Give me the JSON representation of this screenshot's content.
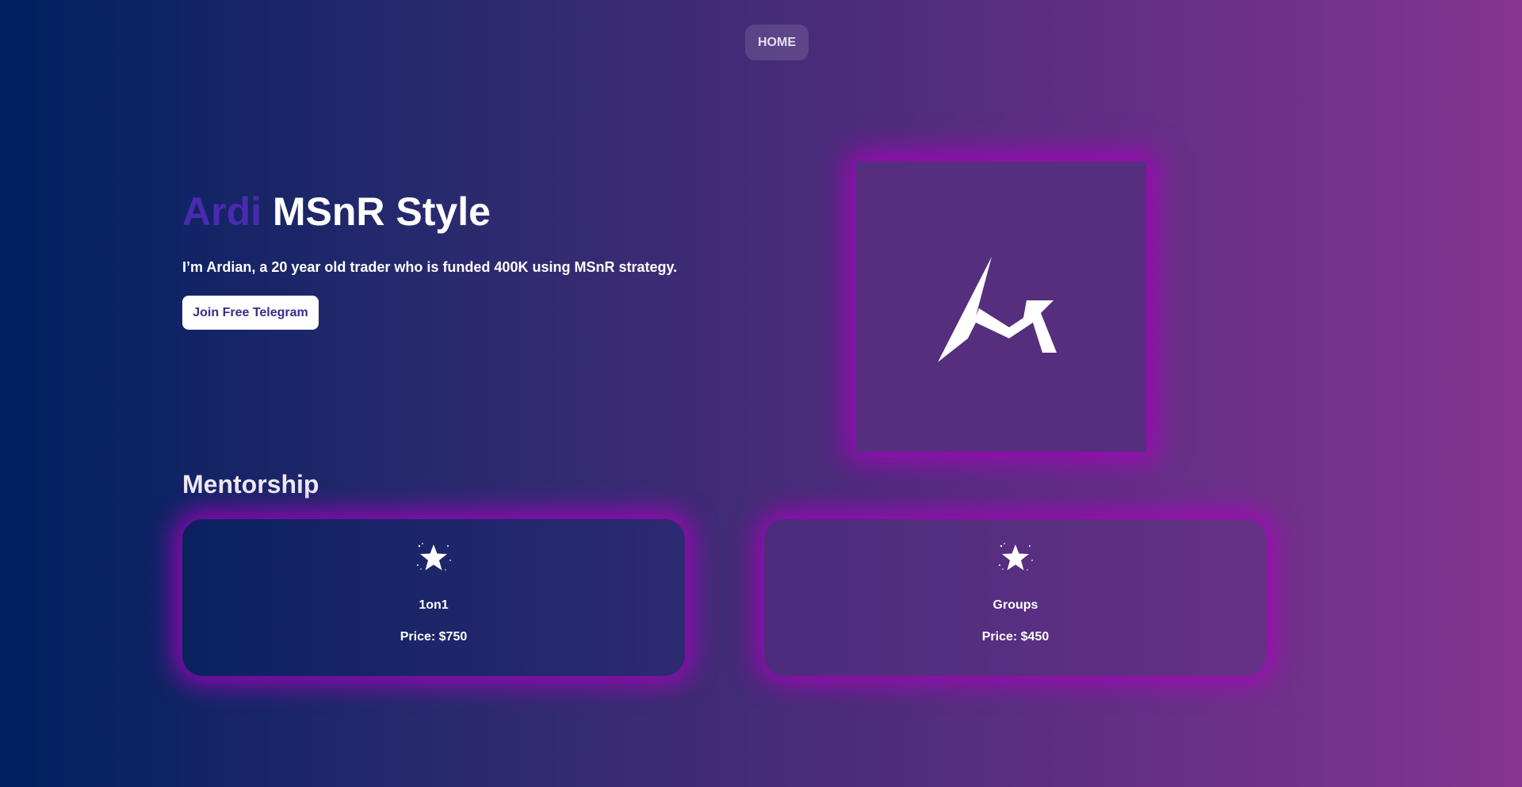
{
  "nav": {
    "home_label": "HOME"
  },
  "hero": {
    "title_accent": "Ardi",
    "title_rest": " MSnR Style",
    "subtitle": "I’m Ardian, a 20 year old trader who is funded 400K using MSnR strategy.",
    "cta_label": "Join Free Telegram"
  },
  "logo": {
    "icon": "chart-arrow-logo-icon"
  },
  "mentorship": {
    "title": "Mentorship",
    "cards": [
      {
        "name": "1on1",
        "price": "Price: $750",
        "icon": "sparkle-star-icon"
      },
      {
        "name": "Groups",
        "price": "Price: $450",
        "icon": "sparkle-star-icon"
      }
    ]
  },
  "colors": {
    "accent": "#4a2ab0",
    "glow": "#aa00be",
    "button_text": "#3a2a8c",
    "bg_left": "#00205f",
    "bg_right": "#85358f"
  }
}
